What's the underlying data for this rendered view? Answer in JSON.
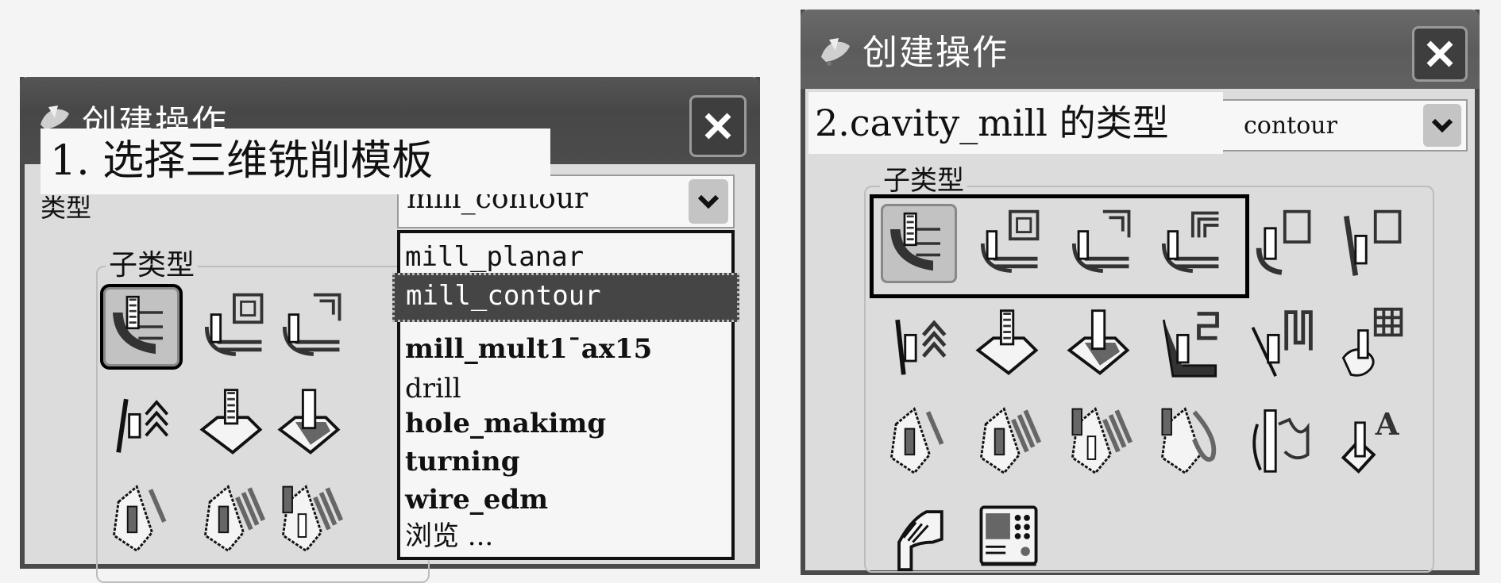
{
  "left_dialog": {
    "title": "创建操作",
    "close_icon": "close-icon",
    "annotation": "1. 选择三维铣削模板",
    "type_label": "类型",
    "type_value": "mill_contour",
    "subtype_label": "子类型",
    "dropdown_options": [
      {
        "label": "mill_planar",
        "selected": false
      },
      {
        "label": "mill_contour",
        "selected": true
      },
      {
        "label": "mill_mult1¯ax15",
        "selected": false
      },
      {
        "label": "drill",
        "selected": false
      },
      {
        "label": "hole_makimg",
        "selected": false
      },
      {
        "label": "turning",
        "selected": false
      },
      {
        "label": "wire_edm",
        "selected": false
      },
      {
        "label": "浏览 ...",
        "selected": false
      }
    ],
    "subtype_icons": [
      "cavity-mill-icon",
      "plunge-milling-icon",
      "corner-rough-icon",
      "zlevel-profile-icon",
      "fixed-contour-icon",
      "contour-area-icon",
      "flowcut-single-icon",
      "flowcut-multiple-icon",
      "flowcut-ref-tool-icon"
    ]
  },
  "right_dialog": {
    "title": "创建操作",
    "close_icon": "close-icon",
    "annotation": "2.cavity_mill 的类型",
    "type_value": "contour",
    "subtype_label": "子类型",
    "subtype_icons": [
      "cavity-mill-icon",
      "plunge-milling-icon",
      "corner-rough-icon",
      "rest-milling-icon",
      "zlevel-profile-icon",
      "zlevel-corner-icon",
      "zlevel-steep-icon",
      "fixed-contour-icon",
      "contour-area-icon",
      "contour-surface-area-icon",
      "streamline-icon",
      "contour-zigzag-icon",
      "flowcut-single-icon",
      "flowcut-multiple-icon",
      "flowcut-ref-tool-icon",
      "flowcut-smooth-icon",
      "contour-profile-icon",
      "contour-text-icon",
      "mill-user-icon",
      "mill-control-icon"
    ]
  }
}
